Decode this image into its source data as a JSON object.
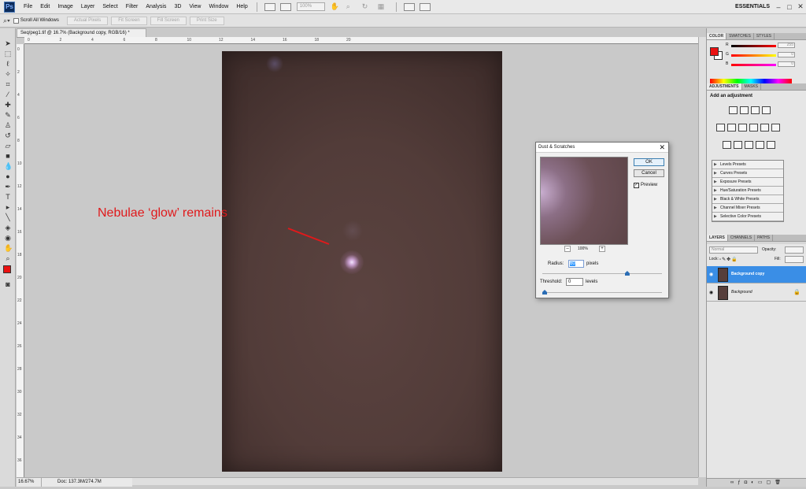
{
  "menubar": {
    "logo": "Ps",
    "items": [
      "File",
      "Edit",
      "Image",
      "Layer",
      "Select",
      "Filter",
      "Analysis",
      "3D",
      "View",
      "Window",
      "Help"
    ],
    "zoom_value": "100%",
    "workspace": "ESSENTIALS",
    "win_controls": [
      "–",
      "□",
      "✕"
    ]
  },
  "options_bar": {
    "scroll_all": "Scroll All Windows",
    "buttons": [
      "Actual Pixels",
      "Fit Screen",
      "Fill Screen",
      "Print Size"
    ]
  },
  "document": {
    "tab_title": "Seq/peg1.tif @ 16.7% (Background copy, RGB/16) *",
    "ruler_top": [
      "0",
      "2",
      "4",
      "6",
      "8",
      "10",
      "12",
      "14",
      "16",
      "18",
      "20"
    ],
    "ruler_left": [
      "0",
      "2",
      "4",
      "6",
      "8",
      "10",
      "12",
      "14",
      "16",
      "18",
      "20",
      "22",
      "24",
      "26",
      "28",
      "30",
      "32",
      "34",
      "36"
    ],
    "annotation": "Nebulae ‘glow’ remains",
    "status_zoom": "16.67%",
    "status_doc": "Doc: 137.3M/274.7M"
  },
  "dialog": {
    "title": "Dust & Scratches",
    "ok": "OK",
    "cancel": "Cancel",
    "preview_label": "Preview",
    "preview_checked": "✓",
    "zoom_pct": "100%",
    "zoom_minus": "–",
    "zoom_plus": "+",
    "radius_label": "Radius:",
    "radius_value": "60",
    "radius_unit": "pixels",
    "radius_fraction": 0.71,
    "threshold_label": "Threshold:",
    "threshold_value": "0",
    "threshold_unit": "levels",
    "threshold_fraction": 0.0
  },
  "color_panel": {
    "tabs": [
      "COLOR",
      "SWATCHES",
      "STYLES"
    ],
    "rows": [
      {
        "label": "R",
        "value": "255"
      },
      {
        "label": "G",
        "value": "0"
      },
      {
        "label": "B",
        "value": "0"
      }
    ],
    "fg": "#ea1111"
  },
  "adjustments_panel": {
    "tabs": [
      "ADJUSTMENTS",
      "MASKS"
    ],
    "title": "Add an adjustment",
    "presets": [
      "Levels Presets",
      "Curves Presets",
      "Exposure Presets",
      "Hue/Saturation Presets",
      "Black & White Presets",
      "Channel Mixer Presets",
      "Selective Color Presets"
    ]
  },
  "layers_panel": {
    "tabs": [
      "LAYERS",
      "CHANNELS",
      "PATHS"
    ],
    "blend_mode": "Normal",
    "opacity_label": "Opacity:",
    "lock_label": "Lock:",
    "fill_label": "Fill:",
    "layers": [
      {
        "name": "Background copy",
        "selected": true
      },
      {
        "name": "Background",
        "selected": false
      }
    ]
  }
}
